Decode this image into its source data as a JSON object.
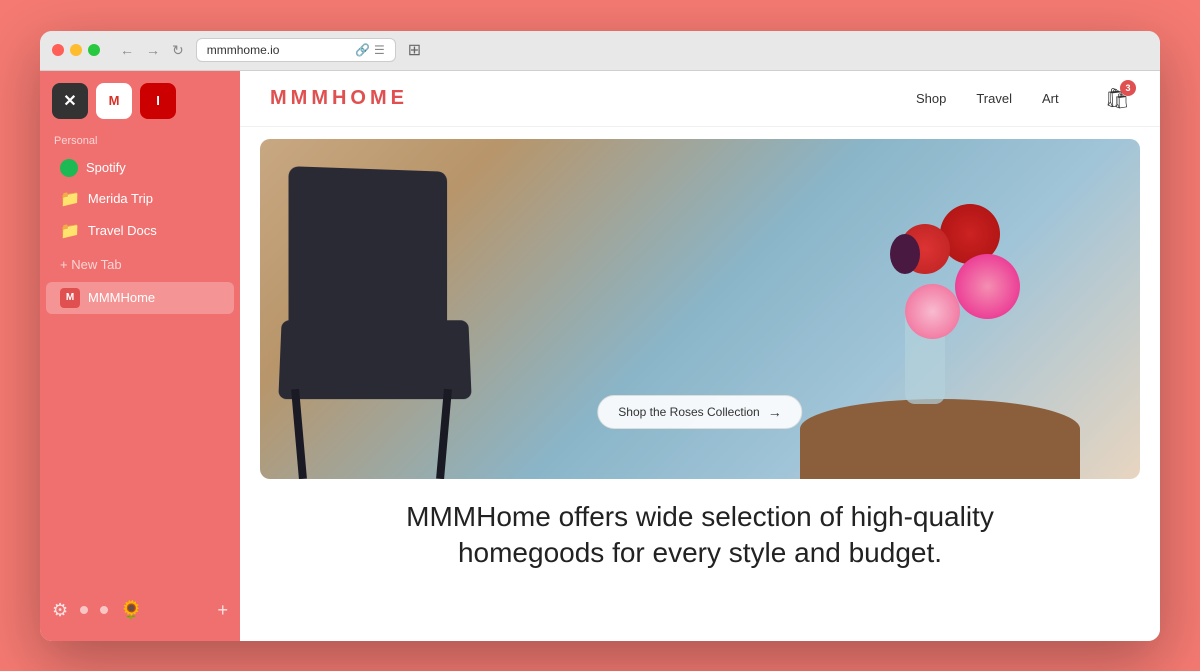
{
  "browser": {
    "url": "mmmhome.io",
    "title": "MMMHome"
  },
  "titlebar": {
    "back_label": "←",
    "forward_label": "→",
    "refresh_label": "↻",
    "sidebar_toggle_label": "⊞"
  },
  "sidebar": {
    "section_label": "Personal",
    "quick_icons": [
      {
        "id": "blocker",
        "symbol": "✕",
        "label": "Ad Blocker"
      },
      {
        "id": "gmail",
        "symbol": "M",
        "label": "Gmail"
      },
      {
        "id": "instapaper",
        "symbol": "I",
        "label": "Instapaper"
      }
    ],
    "items": [
      {
        "id": "spotify",
        "label": "Spotify",
        "icon_type": "spotify"
      },
      {
        "id": "merida",
        "label": "Merida Trip",
        "icon_type": "folder-blue"
      },
      {
        "id": "travel-docs",
        "label": "Travel Docs",
        "icon_type": "folder-purple"
      }
    ],
    "new_tab_label": "+ New Tab",
    "active_tab": "MMMHome",
    "active_tab_icon": "M",
    "bottom": {
      "settings_icon": "⚙",
      "dots": [
        "inactive",
        "inactive",
        "active"
      ],
      "sunflower_icon": "🌻",
      "add_icon": "+"
    }
  },
  "website": {
    "logo": "MMMHOME",
    "nav_links": [
      {
        "id": "shop",
        "label": "Shop"
      },
      {
        "id": "travel",
        "label": "Travel"
      },
      {
        "id": "art",
        "label": "Art"
      }
    ],
    "cart_badge": "3",
    "hero_cta": "Shop the Roses Collection",
    "hero_cta_arrow": "→",
    "description_line1": "MMMHome offers wide selection of high-quality",
    "description_line2": "homegoods for every style and budget."
  },
  "colors": {
    "brand_red": "#e05050",
    "sidebar_bg": "#f07070",
    "outer_bg": "#f47a72",
    "logo_color": "#e05050"
  }
}
